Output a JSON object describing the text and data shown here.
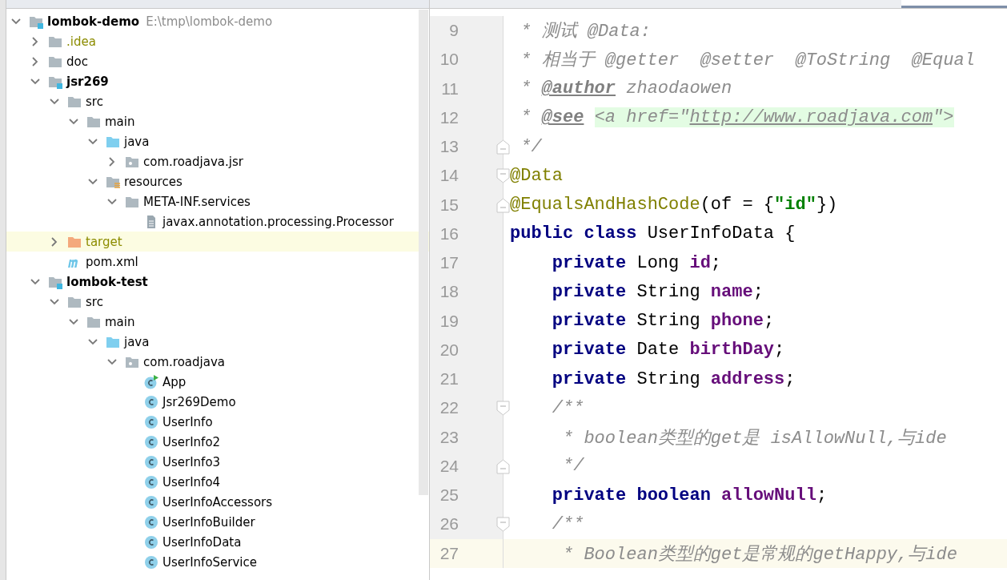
{
  "project_tree": [
    {
      "label": "lombok-demo",
      "hint": "E:\\tmp\\lombok-demo",
      "kind": "module",
      "bold": true,
      "expanded": true,
      "selected": false,
      "children": [
        {
          "label": ".idea",
          "kind": "folder",
          "expanded": false,
          "selected": false,
          "color": "#8c8c00"
        },
        {
          "label": "doc",
          "kind": "folder",
          "expanded": false,
          "selected": false
        },
        {
          "label": "jsr269",
          "kind": "module",
          "bold": true,
          "expanded": true,
          "selected": false,
          "children": [
            {
              "label": "src",
              "kind": "folder",
              "expanded": true,
              "selected": false,
              "children": [
                {
                  "label": "main",
                  "kind": "folder",
                  "expanded": true,
                  "selected": false,
                  "children": [
                    {
                      "label": "java",
                      "kind": "source",
                      "expanded": true,
                      "selected": false,
                      "children": [
                        {
                          "label": "com.roadjava.jsr",
                          "kind": "package",
                          "expanded": false,
                          "selected": false
                        }
                      ]
                    },
                    {
                      "label": "resources",
                      "kind": "resources",
                      "expanded": true,
                      "selected": false,
                      "children": [
                        {
                          "label": "META-INF.services",
                          "kind": "folder",
                          "expanded": true,
                          "selected": false,
                          "children": [
                            {
                              "label": "javax.annotation.processing.Processor",
                              "kind": "textfile",
                              "selected": false
                            }
                          ]
                        }
                      ]
                    }
                  ]
                }
              ]
            },
            {
              "label": "target",
              "kind": "excluded",
              "expanded": false,
              "selected": true,
              "color": "#8c8c00"
            },
            {
              "label": "pom.xml",
              "kind": "maven",
              "selected": false
            }
          ]
        },
        {
          "label": "lombok-test",
          "kind": "module",
          "bold": true,
          "expanded": true,
          "selected": false,
          "children": [
            {
              "label": "src",
              "kind": "folder",
              "expanded": true,
              "selected": false,
              "children": [
                {
                  "label": "main",
                  "kind": "folder",
                  "expanded": true,
                  "selected": false,
                  "children": [
                    {
                      "label": "java",
                      "kind": "source",
                      "expanded": true,
                      "selected": false,
                      "children": [
                        {
                          "label": "com.roadjava",
                          "kind": "package",
                          "expanded": true,
                          "selected": false,
                          "children": [
                            {
                              "label": "App",
                              "kind": "runclass",
                              "selected": false
                            },
                            {
                              "label": "Jsr269Demo",
                              "kind": "class",
                              "selected": false
                            },
                            {
                              "label": "UserInfo",
                              "kind": "class",
                              "selected": false
                            },
                            {
                              "label": "UserInfo2",
                              "kind": "class",
                              "selected": false
                            },
                            {
                              "label": "UserInfo3",
                              "kind": "class",
                              "selected": false
                            },
                            {
                              "label": "UserInfo4",
                              "kind": "class",
                              "selected": false
                            },
                            {
                              "label": "UserInfoAccessors",
                              "kind": "class",
                              "selected": false
                            },
                            {
                              "label": "UserInfoBuilder",
                              "kind": "class",
                              "selected": false
                            },
                            {
                              "label": "UserInfoData",
                              "kind": "class",
                              "selected": false
                            },
                            {
                              "label": "UserInfoService",
                              "kind": "class",
                              "selected": false
                            }
                          ]
                        }
                      ]
                    }
                  ]
                }
              ]
            }
          ]
        }
      ]
    }
  ],
  "editor": {
    "lines": [
      {
        "number": "9",
        "current": false,
        "fold_start": false,
        "fold_end": false,
        "tokens": [
          {
            "kind": "comment",
            "text": " * 测试 @Data:"
          }
        ]
      },
      {
        "number": "10",
        "current": false,
        "fold_start": false,
        "fold_end": false,
        "tokens": [
          {
            "kind": "comment",
            "text": " * 相当于 @getter  @setter  @ToString  @Equal"
          }
        ]
      },
      {
        "number": "11",
        "current": false,
        "fold_start": false,
        "fold_end": false,
        "tokens": [
          {
            "kind": "comment",
            "text": " * "
          },
          {
            "kind": "doctag",
            "text": "@author"
          },
          {
            "kind": "comment",
            "text": " zhaodaowen"
          }
        ]
      },
      {
        "number": "12",
        "current": false,
        "fold_start": false,
        "fold_end": false,
        "tokens": [
          {
            "kind": "comment",
            "text": " * "
          },
          {
            "kind": "doctag",
            "text": "@see"
          },
          {
            "kind": "html",
            "text": " <a href=\""
          },
          {
            "kind": "url",
            "text": "http://www.roadjava.com"
          },
          {
            "kind": "html",
            "text": "\">"
          }
        ]
      },
      {
        "number": "13",
        "current": false,
        "fold_start": false,
        "fold_end": true,
        "tokens": [
          {
            "kind": "comment",
            "text": " */"
          }
        ]
      },
      {
        "number": "14",
        "current": false,
        "fold_start": true,
        "fold_end": false,
        "tokens": [
          {
            "kind": "annotation",
            "text": "@Data"
          }
        ]
      },
      {
        "number": "15",
        "current": false,
        "fold_start": false,
        "fold_end": true,
        "tokens": [
          {
            "kind": "annotation",
            "text": "@EqualsAndHashCode"
          },
          {
            "kind": "plain",
            "text": "(of = {"
          },
          {
            "kind": "string",
            "text": "\"id\""
          },
          {
            "kind": "plain",
            "text": "})"
          }
        ]
      },
      {
        "number": "16",
        "current": false,
        "fold_start": false,
        "fold_end": false,
        "tokens": [
          {
            "kind": "keyword",
            "text": "public class "
          },
          {
            "kind": "plain",
            "text": "UserInfoData {"
          }
        ]
      },
      {
        "number": "17",
        "current": false,
        "fold_start": false,
        "fold_end": false,
        "tokens": [
          {
            "kind": "keyword",
            "text": "    private "
          },
          {
            "kind": "plain",
            "text": "Long "
          },
          {
            "kind": "field",
            "text": "id"
          },
          {
            "kind": "plain",
            "text": ";"
          }
        ]
      },
      {
        "number": "18",
        "current": false,
        "fold_start": false,
        "fold_end": false,
        "tokens": [
          {
            "kind": "keyword",
            "text": "    private "
          },
          {
            "kind": "plain",
            "text": "String "
          },
          {
            "kind": "field",
            "text": "name"
          },
          {
            "kind": "plain",
            "text": ";"
          }
        ]
      },
      {
        "number": "19",
        "current": false,
        "fold_start": false,
        "fold_end": false,
        "tokens": [
          {
            "kind": "keyword",
            "text": "    private "
          },
          {
            "kind": "plain",
            "text": "String "
          },
          {
            "kind": "field",
            "text": "phone"
          },
          {
            "kind": "plain",
            "text": ";"
          }
        ]
      },
      {
        "number": "20",
        "current": false,
        "fold_start": false,
        "fold_end": false,
        "tokens": [
          {
            "kind": "keyword",
            "text": "    private "
          },
          {
            "kind": "plain",
            "text": "Date "
          },
          {
            "kind": "field",
            "text": "birthDay"
          },
          {
            "kind": "plain",
            "text": ";"
          }
        ]
      },
      {
        "number": "21",
        "current": false,
        "fold_start": false,
        "fold_end": false,
        "tokens": [
          {
            "kind": "keyword",
            "text": "    private "
          },
          {
            "kind": "plain",
            "text": "String "
          },
          {
            "kind": "field",
            "text": "address"
          },
          {
            "kind": "plain",
            "text": ";"
          }
        ]
      },
      {
        "number": "22",
        "current": false,
        "fold_start": true,
        "fold_end": false,
        "tokens": [
          {
            "kind": "comment",
            "text": "    /**"
          }
        ]
      },
      {
        "number": "23",
        "current": false,
        "fold_start": false,
        "fold_end": false,
        "tokens": [
          {
            "kind": "comment",
            "text": "     * boolean类型的get是 isAllowNull,与ide"
          }
        ]
      },
      {
        "number": "24",
        "current": false,
        "fold_start": false,
        "fold_end": true,
        "tokens": [
          {
            "kind": "comment",
            "text": "     */"
          }
        ]
      },
      {
        "number": "25",
        "current": false,
        "fold_start": false,
        "fold_end": false,
        "tokens": [
          {
            "kind": "keyword",
            "text": "    private boolean "
          },
          {
            "kind": "field",
            "text": "allowNull"
          },
          {
            "kind": "plain",
            "text": ";"
          }
        ]
      },
      {
        "number": "26",
        "current": false,
        "fold_start": true,
        "fold_end": false,
        "tokens": [
          {
            "kind": "comment",
            "text": "    /**"
          }
        ]
      },
      {
        "number": "27",
        "current": true,
        "fold_start": false,
        "fold_end": false,
        "tokens": [
          {
            "kind": "comment",
            "text": "     * Boolean类型的get是常规的getHappy,与ide"
          }
        ]
      }
    ]
  }
}
